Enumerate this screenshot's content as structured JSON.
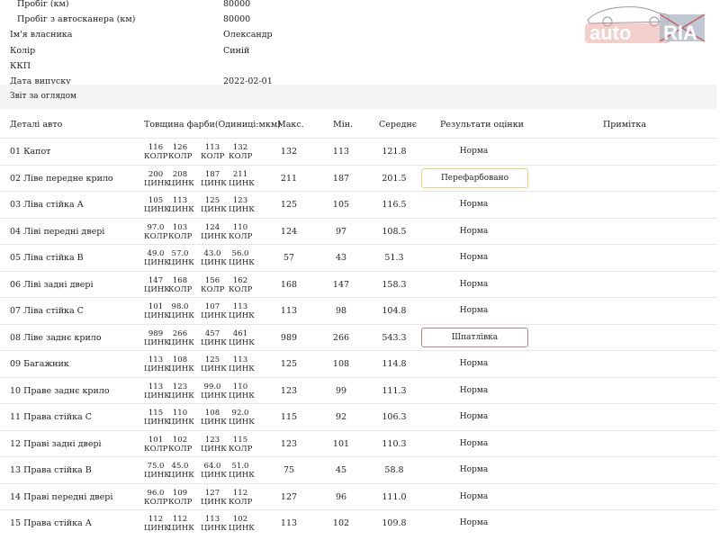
{
  "info": [
    {
      "label": "Пробіг (км)",
      "value": "80000",
      "indent": true
    },
    {
      "label": "Пробіг з автосканера (км)",
      "value": "80000",
      "indent": true
    },
    {
      "label": "Ім'я власника",
      "value": "Олександр",
      "indent": false
    },
    {
      "label": "Колір",
      "value": "Синій",
      "indent": false
    },
    {
      "label": "ККП",
      "value": "",
      "indent": false
    },
    {
      "label": "Дата випуску",
      "value": "2022-02-01",
      "indent": false
    }
  ],
  "section_title": "Звіт за оглядом",
  "headers": {
    "part": "Деталі авто",
    "thickness": "Товщина фарби(Одиниці:мкм)",
    "max": "Макс.",
    "min": "Мін.",
    "avg": "Середнє",
    "result": "Результати оцінки",
    "note": "Примітка"
  },
  "logo": {
    "left": "auto",
    "right": "RIA"
  },
  "rows": [
    {
      "name": "01  Капот",
      "m": [
        [
          "116",
          "КОЛР"
        ],
        [
          "126",
          "КОЛР"
        ],
        [
          "113",
          "КОЛР"
        ],
        [
          "132",
          "КОЛР"
        ]
      ],
      "max": "132",
      "min": "113",
      "avg": "121.8",
      "result": "Норма",
      "style": ""
    },
    {
      "name": "02  Ліве передне крило",
      "m": [
        [
          "200",
          "ЦИНК"
        ],
        [
          "208",
          "ЦИНК"
        ],
        [
          "187",
          "ЦИНК"
        ],
        [
          "211",
          "ЦИНК"
        ]
      ],
      "max": "211",
      "min": "187",
      "avg": "201.5",
      "result": "Перефарбовано",
      "style": "y"
    },
    {
      "name": "03  Ліва стійка А",
      "m": [
        [
          "105",
          "ЦИНК"
        ],
        [
          "113",
          "ЦИНК"
        ],
        [
          "125",
          "ЦИНК"
        ],
        [
          "123",
          "ЦИНК"
        ]
      ],
      "max": "125",
      "min": "105",
      "avg": "116.5",
      "result": "Норма",
      "style": ""
    },
    {
      "name": "04  Ліві передні двері",
      "m": [
        [
          "97.0",
          "КОЛР"
        ],
        [
          "103",
          "КОЛР"
        ],
        [
          "124",
          "ЦИНК"
        ],
        [
          "110",
          "КОЛР"
        ]
      ],
      "max": "124",
      "min": "97",
      "avg": "108.5",
      "result": "Норма",
      "style": ""
    },
    {
      "name": "05  Ліва стійка В",
      "m": [
        [
          "49.0",
          "ЦИНК"
        ],
        [
          "57.0",
          "ЦИНК"
        ],
        [
          "43.0",
          "ЦИНК"
        ],
        [
          "56.0",
          "ЦИНК"
        ]
      ],
      "max": "57",
      "min": "43",
      "avg": "51.3",
      "result": "Норма",
      "style": ""
    },
    {
      "name": "06  Ліві задні двері",
      "m": [
        [
          "147",
          "ЦИНК"
        ],
        [
          "168",
          "КОЛР"
        ],
        [
          "156",
          "КОЛР"
        ],
        [
          "162",
          "КОЛР"
        ]
      ],
      "max": "168",
      "min": "147",
      "avg": "158.3",
      "result": "Норма",
      "style": ""
    },
    {
      "name": "07  Ліва стійка С",
      "m": [
        [
          "101",
          "ЦИНК"
        ],
        [
          "98.0",
          "ЦИНК"
        ],
        [
          "107",
          "ЦИНК"
        ],
        [
          "113",
          "ЦИНК"
        ]
      ],
      "max": "113",
      "min": "98",
      "avg": "104.8",
      "result": "Норма",
      "style": ""
    },
    {
      "name": "08  Ліве заднє крило",
      "m": [
        [
          "989",
          "ЦИНК"
        ],
        [
          "266",
          "ЦИНК"
        ],
        [
          "457",
          "ЦИНК"
        ],
        [
          "461",
          "ЦИНК"
        ]
      ],
      "max": "989",
      "min": "266",
      "avg": "543.3",
      "result": "Шпатлівка",
      "style": "r"
    },
    {
      "name": "09  Багажник",
      "m": [
        [
          "113",
          "ЦИНК"
        ],
        [
          "108",
          "ЦИНК"
        ],
        [
          "125",
          "ЦИНК"
        ],
        [
          "113",
          "ЦИНК"
        ]
      ],
      "max": "125",
      "min": "108",
      "avg": "114.8",
      "result": "Норма",
      "style": ""
    },
    {
      "name": "10  Праве заднє крило",
      "m": [
        [
          "113",
          "ЦИНК"
        ],
        [
          "123",
          "ЦИНК"
        ],
        [
          "99.0",
          "ЦИНК"
        ],
        [
          "110",
          "ЦИНК"
        ]
      ],
      "max": "123",
      "min": "99",
      "avg": "111.3",
      "result": "Норма",
      "style": ""
    },
    {
      "name": "11  Права стійка С",
      "m": [
        [
          "115",
          "ЦИНК"
        ],
        [
          "110",
          "ЦИНК"
        ],
        [
          "108",
          "ЦИНК"
        ],
        [
          "92.0",
          "ЦИНК"
        ]
      ],
      "max": "115",
      "min": "92",
      "avg": "106.3",
      "result": "Норма",
      "style": ""
    },
    {
      "name": "12  Праві задні двері",
      "m": [
        [
          "101",
          "КОЛР"
        ],
        [
          "102",
          "КОЛР"
        ],
        [
          "123",
          "ЦИНК"
        ],
        [
          "115",
          "КОЛР"
        ]
      ],
      "max": "123",
      "min": "101",
      "avg": "110.3",
      "result": "Норма",
      "style": ""
    },
    {
      "name": "13  Права стійка В",
      "m": [
        [
          "75.0",
          "ЦИНК"
        ],
        [
          "45.0",
          "ЦИНК"
        ],
        [
          "64.0",
          "ЦИНК"
        ],
        [
          "51.0",
          "ЦИНК"
        ]
      ],
      "max": "75",
      "min": "45",
      "avg": "58.8",
      "result": "Норма",
      "style": ""
    },
    {
      "name": "14  Праві передні двері",
      "m": [
        [
          "96.0",
          "КОЛР"
        ],
        [
          "109",
          "КОЛР"
        ],
        [
          "127",
          "ЦИНК"
        ],
        [
          "112",
          "КОЛР"
        ]
      ],
      "max": "127",
      "min": "96",
      "avg": "111.0",
      "result": "Норма",
      "style": ""
    },
    {
      "name": "15  Права стійка А",
      "m": [
        [
          "112",
          "ЦИНК"
        ],
        [
          "112",
          "ЦИНК"
        ],
        [
          "113",
          "ЦИНК"
        ],
        [
          "102",
          "ЦИНК"
        ]
      ],
      "max": "113",
      "min": "102",
      "avg": "109.8",
      "result": "Норма",
      "style": ""
    }
  ]
}
